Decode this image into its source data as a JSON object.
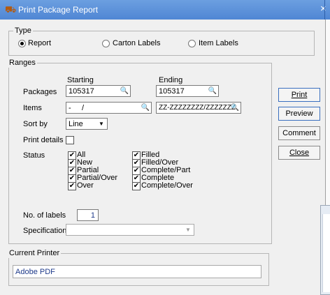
{
  "window": {
    "title": "Print Package Report",
    "close_glyph": "×",
    "app_icon": "app-icon"
  },
  "type_group": {
    "label": "Type",
    "options": [
      {
        "label": "Report",
        "selected": true
      },
      {
        "label": "Carton Labels",
        "selected": false
      },
      {
        "label": "Item Labels",
        "selected": false
      }
    ]
  },
  "ranges": {
    "label": "Ranges",
    "starting_header": "Starting",
    "ending_header": "Ending",
    "packages_label": "Packages",
    "packages_start": "105317",
    "packages_end": "105317",
    "items_label": "Items",
    "items_start": "-     /",
    "items_end": "ZZ-ZZZZZZZZ/ZZZZZZZ",
    "sort_label": "Sort by",
    "sort_value": "Line",
    "print_details_label": "Print details",
    "status_label": "Status",
    "status_left": [
      "All",
      "New",
      "Partial",
      "Partial/Over",
      "Over"
    ],
    "status_right": [
      "Filled",
      "Filled/Over",
      "Complete/Part",
      "Complete",
      "Complete/Over"
    ],
    "labels_label": "No. of labels",
    "labels_value": "1",
    "spec_label": "Specification",
    "spec_value": ""
  },
  "buttons": {
    "print": "Print",
    "preview": "Preview",
    "comment": "Comment",
    "close": "Close"
  },
  "printer": {
    "label": "Current Printer",
    "value": "Adobe PDF"
  }
}
